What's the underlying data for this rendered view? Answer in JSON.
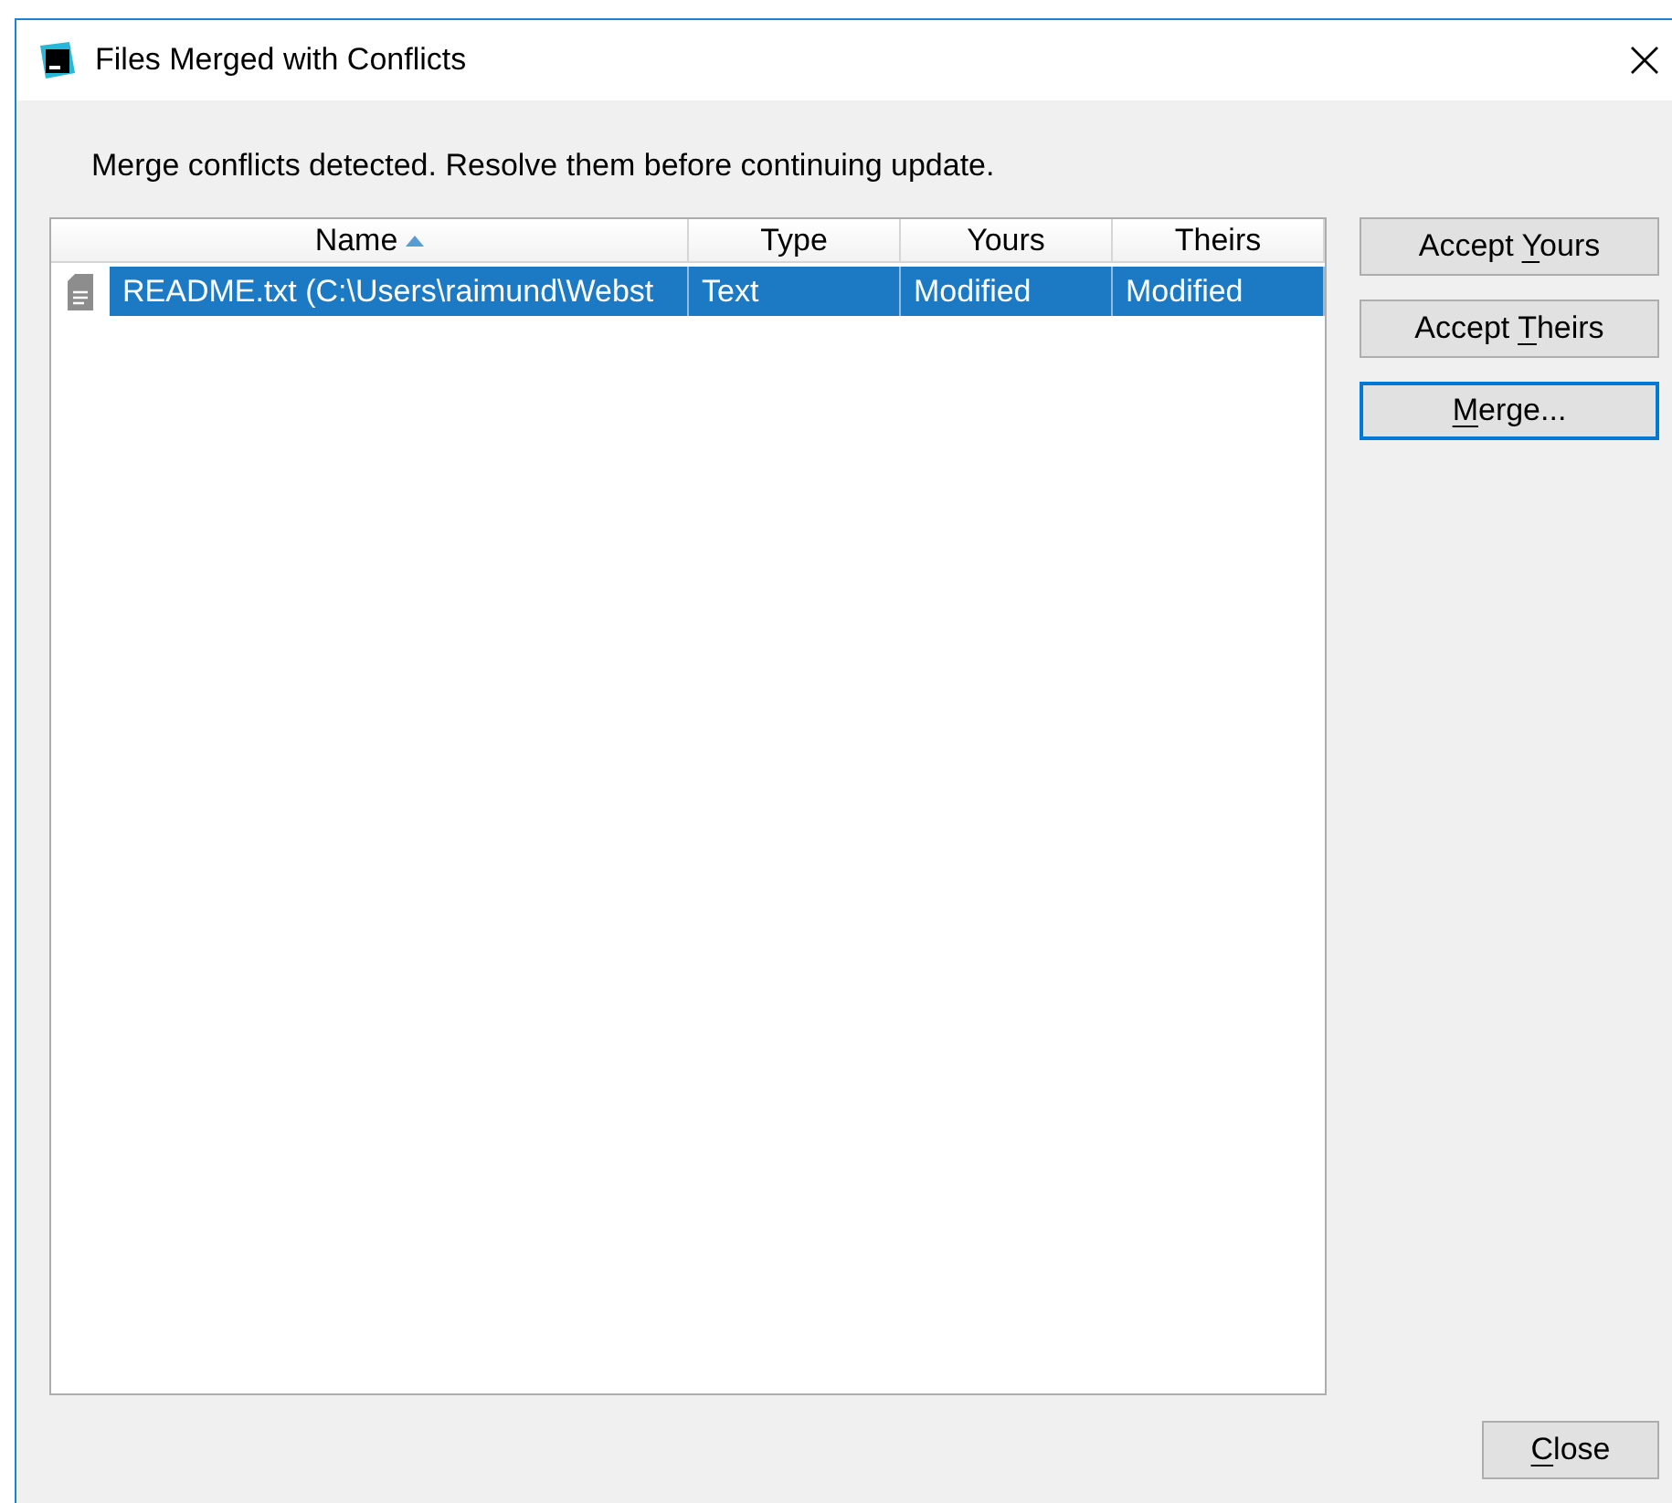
{
  "window": {
    "title": "Files Merged with Conflicts"
  },
  "message": "Merge conflicts detected. Resolve them before continuing update.",
  "table": {
    "columns": [
      {
        "label": "Name",
        "sorted": true
      },
      {
        "label": "Type",
        "sorted": false
      },
      {
        "label": "Yours",
        "sorted": false
      },
      {
        "label": "Theirs",
        "sorted": false
      }
    ],
    "rows": [
      {
        "selected": true,
        "cells": [
          "README.txt (C:\\Users\\raimund\\Webst",
          "Text",
          "Modified",
          "Modified"
        ]
      }
    ]
  },
  "side_buttons": [
    {
      "pre": "Accept ",
      "key": "Y",
      "post": "ours",
      "focused": false
    },
    {
      "pre": "Accept ",
      "key": "T",
      "post": "heirs",
      "focused": false
    },
    {
      "key": "M",
      "post": "erge...",
      "focused": true
    }
  ],
  "close_button": {
    "key": "C",
    "post": "lose"
  }
}
